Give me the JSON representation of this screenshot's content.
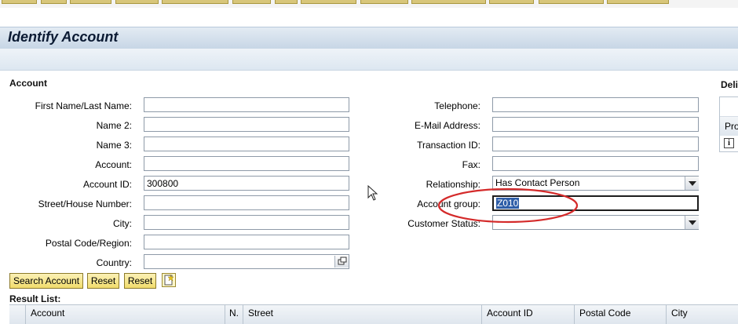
{
  "page": {
    "title": "Identify Account"
  },
  "account_section": {
    "heading": "Account"
  },
  "right_section": {
    "heading_partial": "Deli",
    "column_partial": "Pro",
    "info_icon": "info-icon"
  },
  "form_left": {
    "first_last_name": {
      "label": "First Name/Last Name:",
      "value": ""
    },
    "name2": {
      "label": "Name 2:",
      "value": ""
    },
    "name3": {
      "label": "Name 3:",
      "value": ""
    },
    "account": {
      "label": "Account:",
      "value": ""
    },
    "account_id": {
      "label": "Account ID:",
      "value": "300800"
    },
    "street_house": {
      "label": "Street/House Number:",
      "value": ""
    },
    "city": {
      "label": "City:",
      "value": ""
    },
    "postal_region": {
      "label": "Postal Code/Region:",
      "value": ""
    },
    "country": {
      "label": "Country:",
      "value": ""
    }
  },
  "form_right": {
    "telephone": {
      "label": "Telephone:",
      "value": ""
    },
    "email": {
      "label": "E-Mail Address:",
      "value": ""
    },
    "transaction_id": {
      "label": "Transaction ID:",
      "value": ""
    },
    "fax": {
      "label": "Fax:",
      "value": ""
    },
    "relationship": {
      "label": "Relationship:",
      "value": "Has Contact Person"
    },
    "account_group": {
      "label": "Account group:",
      "value": "Z010"
    },
    "customer_status": {
      "label": "Customer Status:",
      "value": ""
    }
  },
  "buttons": {
    "search_account": "Search Account",
    "reset1": "Reset",
    "reset2": "Reset"
  },
  "results": {
    "heading": "Result List:",
    "columns": [
      "Account",
      "N.",
      "Street",
      "Account ID",
      "Postal Code",
      "City"
    ]
  },
  "colors": {
    "button_yellow": "#f1dc6c",
    "annotation_red": "#d42a2a",
    "title_bar": "#c7d6e6"
  }
}
